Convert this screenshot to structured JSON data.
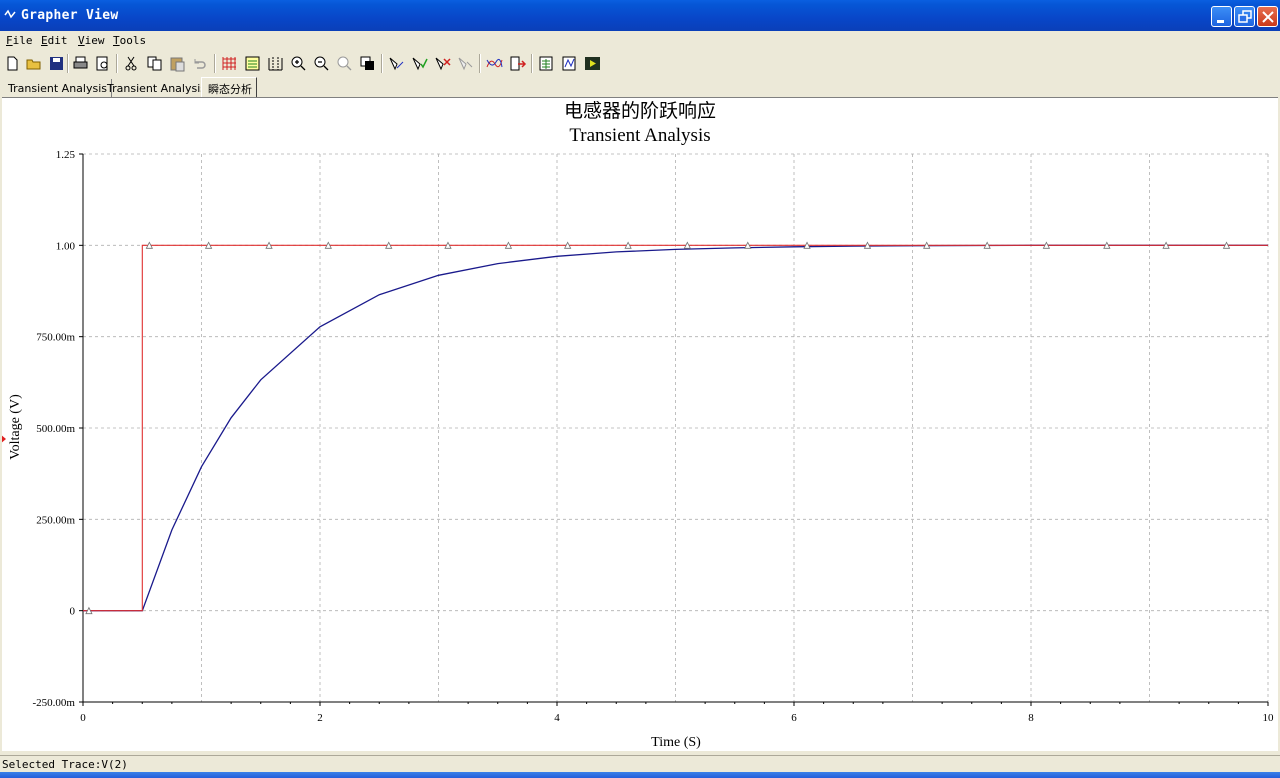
{
  "window": {
    "title": "Grapher View"
  },
  "menu": [
    {
      "key": "F",
      "rest": "ile"
    },
    {
      "key": "E",
      "rest": "dit"
    },
    {
      "key": "V",
      "rest": "iew"
    },
    {
      "key": "T",
      "rest": "ools"
    }
  ],
  "toolbar": [
    "new-icon",
    "open-icon",
    "save-icon",
    "print-icon",
    "print-preview-icon",
    "cut-icon",
    "copy-icon",
    "paste-icon",
    "undo-icon",
    "grid-icon",
    "legend-icon",
    "cursors-icon",
    "zoom-in-icon",
    "zoom-out-icon",
    "zoom-full-icon",
    "toggle-bg-icon",
    "select-trace-icon",
    "trace-check-icon",
    "remove-trace-icon",
    "disabled-trace-icon",
    "overlay-traces-icon",
    "export-icon",
    "excel-export-icon",
    "measure-icon",
    "run-icon"
  ],
  "tabs": [
    "Transient Analysis",
    "Transient Analysis",
    "瞬态分析"
  ],
  "status": {
    "text": "Selected Trace:V(2)"
  },
  "colors": {
    "trace_red": "#e03030",
    "trace_blue": "#1a1a8c",
    "grid": "#b0b0b0",
    "accent": "#0846c8"
  },
  "chart_data": {
    "type": "line",
    "title": "电感器的阶跃响应",
    "subtitle": "Transient Analysis",
    "xlabel": "Time (S)",
    "ylabel": "Voltage (V)",
    "xlim": [
      0,
      10
    ],
    "ylim": [
      -0.25,
      1.25
    ],
    "x_ticks": [
      "0",
      "2",
      "4",
      "6",
      "8",
      "10"
    ],
    "y_ticks": [
      {
        "v": 1.25,
        "label": "1.25"
      },
      {
        "v": 1.0,
        "label": "1.00"
      },
      {
        "v": 0.75,
        "label": "750.00m"
      },
      {
        "v": 0.5,
        "label": "500.00m"
      },
      {
        "v": 0.25,
        "label": "250.00m"
      },
      {
        "v": 0.0,
        "label": "0"
      },
      {
        "v": -0.25,
        "label": "-250.00m"
      }
    ],
    "grid": true,
    "series": [
      {
        "color": "#e03030",
        "marker": "triangle",
        "x": [
          0,
          0.5,
          0.5,
          10
        ],
        "y": [
          0,
          0,
          1,
          1
        ],
        "marker_x": [
          0.05,
          0.56,
          1.06,
          1.57,
          2.07,
          2.58,
          3.08,
          3.59,
          4.09,
          4.6,
          5.1,
          5.61,
          6.11,
          6.62,
          7.12,
          7.63,
          8.13,
          8.64,
          9.14,
          9.65
        ]
      },
      {
        "color": "#1a1a8c",
        "x": [
          0,
          0.5,
          0.75,
          1.0,
          1.25,
          1.5,
          2.0,
          2.5,
          3.0,
          3.5,
          4.0,
          4.5,
          5.0,
          5.5,
          6.0,
          6.5,
          7.0,
          8.0,
          9.0,
          10.0
        ],
        "y": [
          0,
          0,
          0.221,
          0.394,
          0.528,
          0.632,
          0.777,
          0.865,
          0.918,
          0.95,
          0.97,
          0.982,
          0.989,
          0.993,
          0.996,
          0.998,
          0.999,
          1.0,
          1.0,
          1.0
        ]
      }
    ]
  }
}
